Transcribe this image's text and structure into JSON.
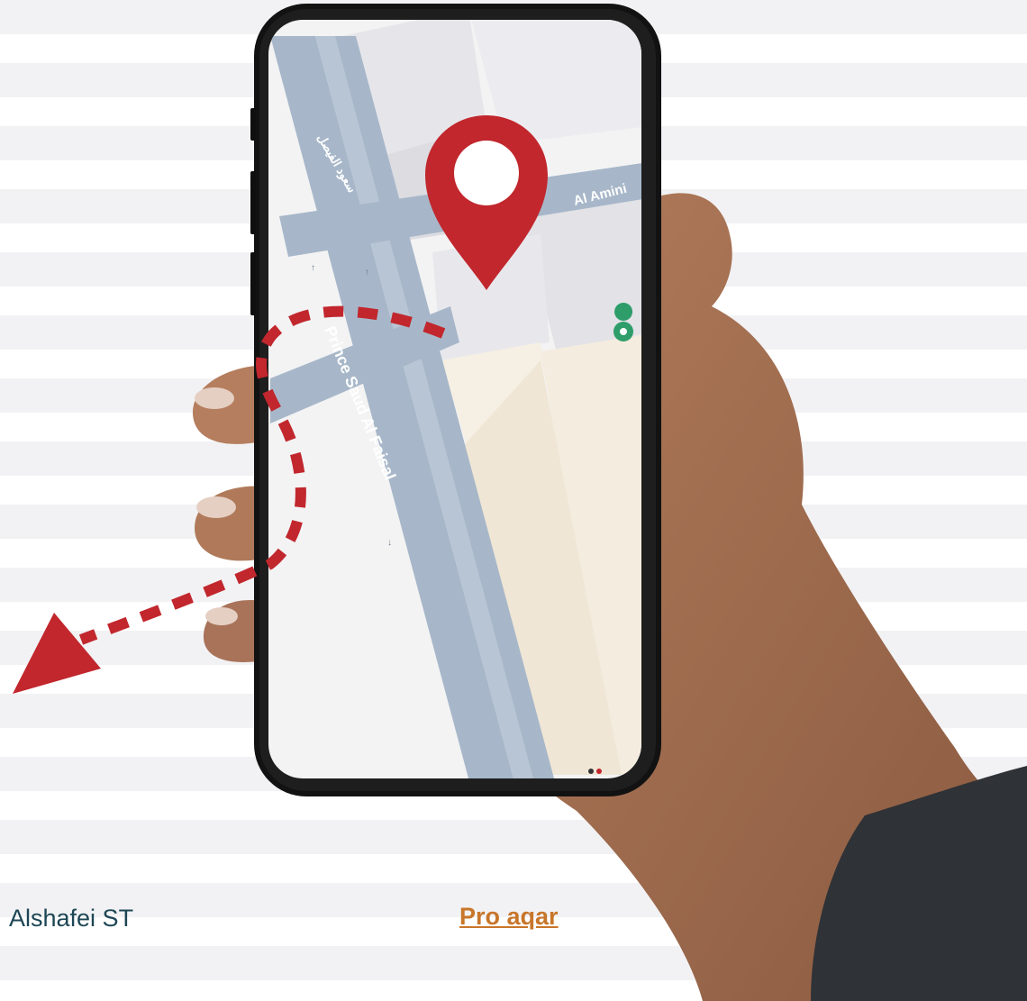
{
  "map": {
    "street_main": "Prince Saud Al Faisal",
    "street_side": "Al Amini",
    "street_arabic": "سعود الفيصل"
  },
  "footer": {
    "location_text": "Alshafei ST",
    "brand_link": "Pro aqar"
  },
  "colors": {
    "accent": "#c1272d",
    "road": "#a7b7c9",
    "link": "#c8762a",
    "text": "#1d4654",
    "poi": "#2e9d6a"
  },
  "icons": [
    "map-pin-icon",
    "poi-marker-icon",
    "dashed-arrow-icon"
  ]
}
